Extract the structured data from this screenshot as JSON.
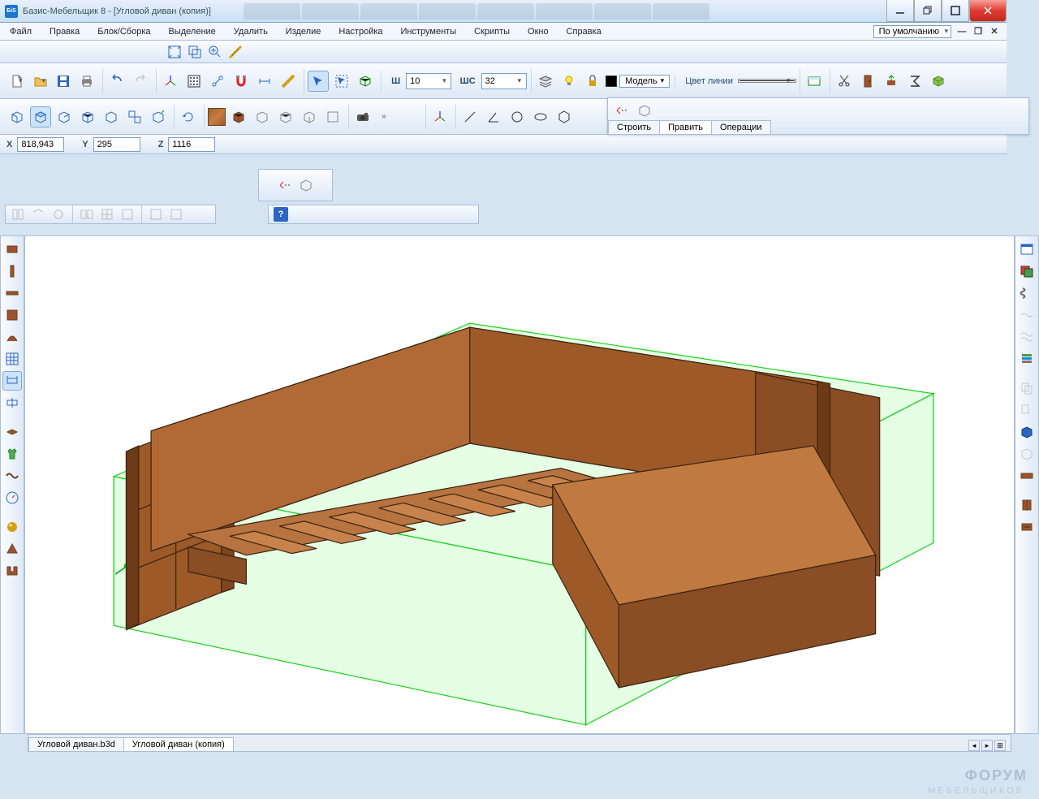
{
  "title": "Базис-Мебельщик 8 - [Угловой диван (копия)]",
  "app_icon_text": "БiS",
  "menu": [
    "Файл",
    "Правка",
    "Блок/Сборка",
    "Выделение",
    "Удалить",
    "Изделие",
    "Настройка",
    "Инструменты",
    "Скрипты",
    "Окно",
    "Справка"
  ],
  "top_right_dropdown": "По умолчанию",
  "toolbar2": {
    "sh_label": "Ш",
    "sh_value": "10",
    "shs_label": "ШС",
    "shs_value": "32",
    "model_label": "Модель",
    "line_color_label": "Цвет линии"
  },
  "coords": {
    "x_label": "X",
    "x": "818,943",
    "y_label": "Y",
    "y": "295",
    "z_label": "Z",
    "z": "1116"
  },
  "float_tabs": [
    "Строить",
    "Править",
    "Операции"
  ],
  "bottom_tabs": [
    "Угловой диван.b3d",
    "Угловой диван (копия)"
  ],
  "watermark": "ФОРУМ",
  "watermark_sub": "МЕБЕЛЬЩИКОВ"
}
